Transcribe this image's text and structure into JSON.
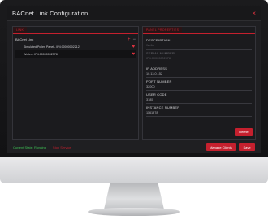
{
  "window": {
    "title": "BACnet Link Configuration",
    "close_icon": "×"
  },
  "left_panel": {
    "tab_label": "Link",
    "root_label": "BACnet Link",
    "add_icon": "+",
    "remove_icon": "−",
    "items": [
      {
        "label": "Simulated Pollen Panel - IP4:00000002212",
        "icon": "heart-icon"
      },
      {
        "label": "Weller - IP4:00000002378",
        "icon": "heart-icon"
      }
    ]
  },
  "right_panel": {
    "tab_label": "Panel Properties",
    "fields": {
      "description": {
        "label": "Description",
        "value": "Weller"
      },
      "serial_number": {
        "label": "Serial Number",
        "value": "IP4:00000002378"
      },
      "ip_address": {
        "label": "IP Address",
        "value": "10.13.0.152"
      },
      "port_number": {
        "label": "Port Number",
        "value": "32000"
      },
      "user_code": {
        "label": "User Code",
        "value": "3185"
      },
      "instance_number": {
        "label": "Instance Number",
        "value": "1161978"
      }
    },
    "delete_label": "Delete"
  },
  "footer": {
    "status": "Current State: Running",
    "stop_label": "Stop Service",
    "manage_label": "Manage Clients",
    "save_label": "Save"
  },
  "colors": {
    "accent": "#c5202e",
    "status_running": "#3fbe55"
  }
}
